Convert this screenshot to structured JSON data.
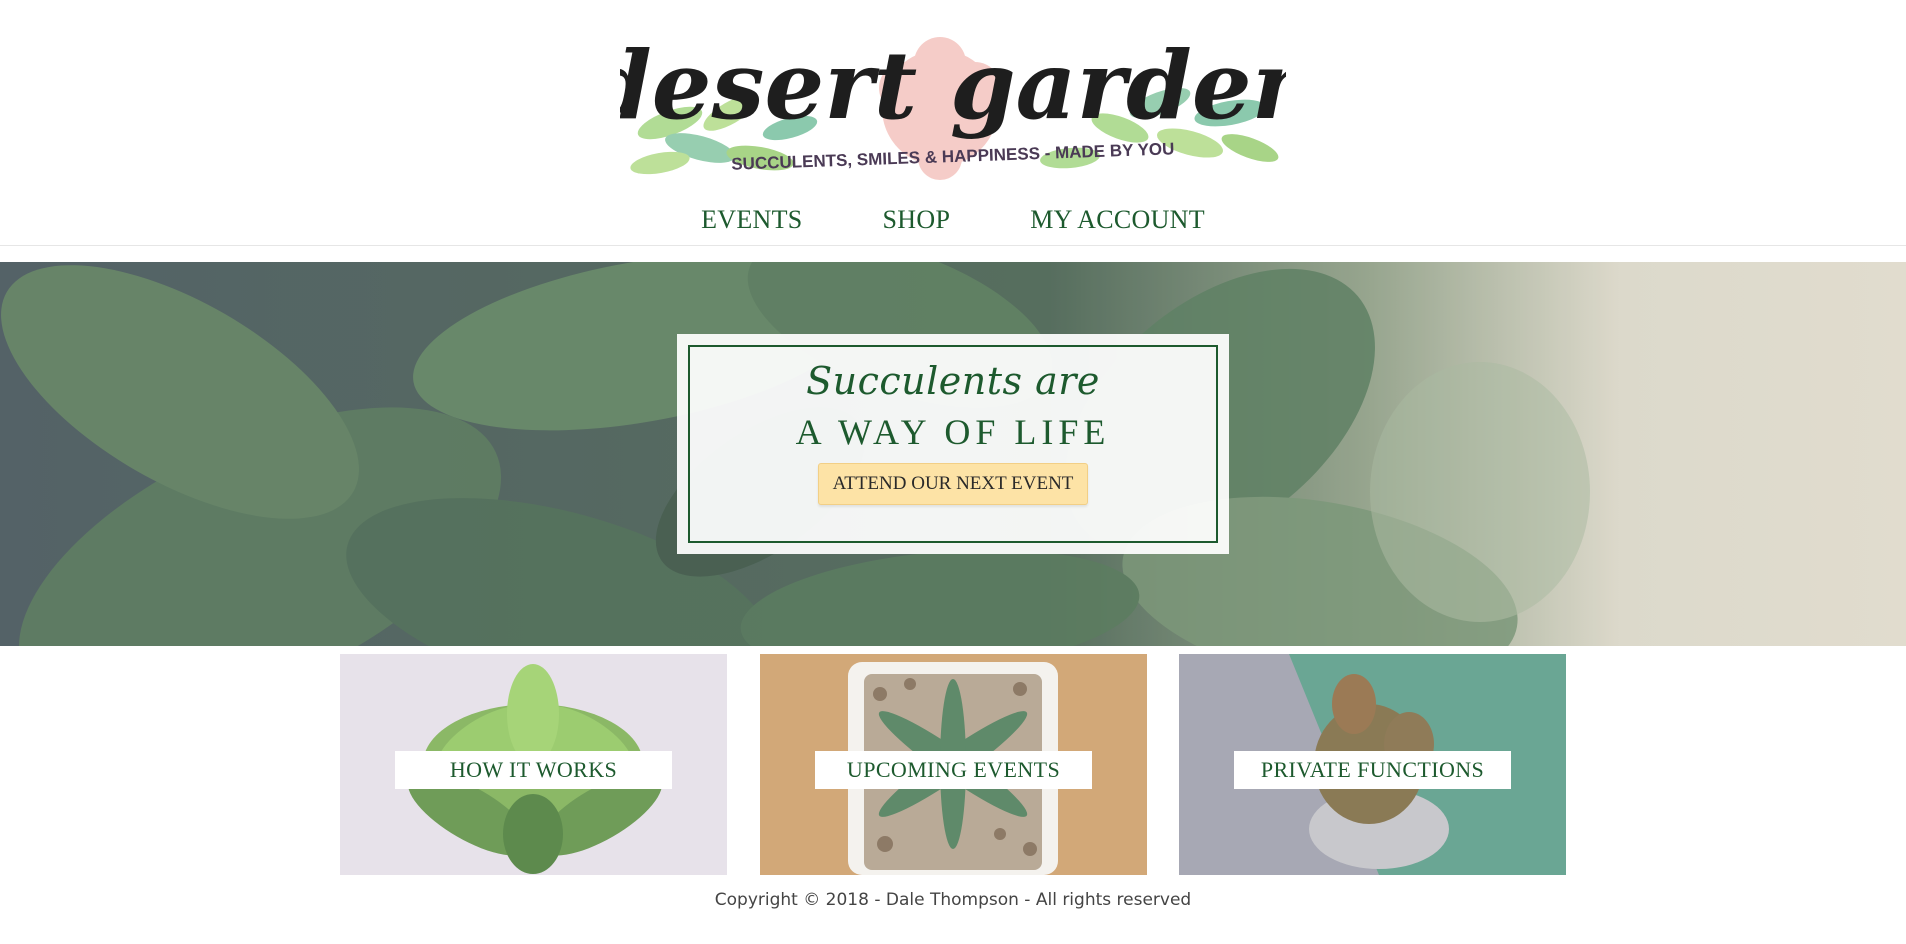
{
  "brand": {
    "logo_name": "desert garden",
    "tagline": "SUCCULENTS, SMILES & HAPPINESS - MADE BY YOU"
  },
  "nav": {
    "items": [
      {
        "label": "EVENTS"
      },
      {
        "label": "SHOP"
      },
      {
        "label": "MY ACCOUNT"
      }
    ]
  },
  "hero": {
    "script_text": "Succulents are",
    "title": "A WAY OF LIFE",
    "cta_label": "ATTEND OUR NEXT EVENT"
  },
  "cards": [
    {
      "label": "HOW IT WORKS"
    },
    {
      "label": "UPCOMING EVENTS"
    },
    {
      "label": "PRIVATE FUNCTIONS"
    }
  ],
  "footer": {
    "copyright": "Copyright © 2018 - Dale Thompson - All rights reserved"
  },
  "colors": {
    "brand_green": "#1d5a2e",
    "cta_yellow": "#fde3a6"
  }
}
